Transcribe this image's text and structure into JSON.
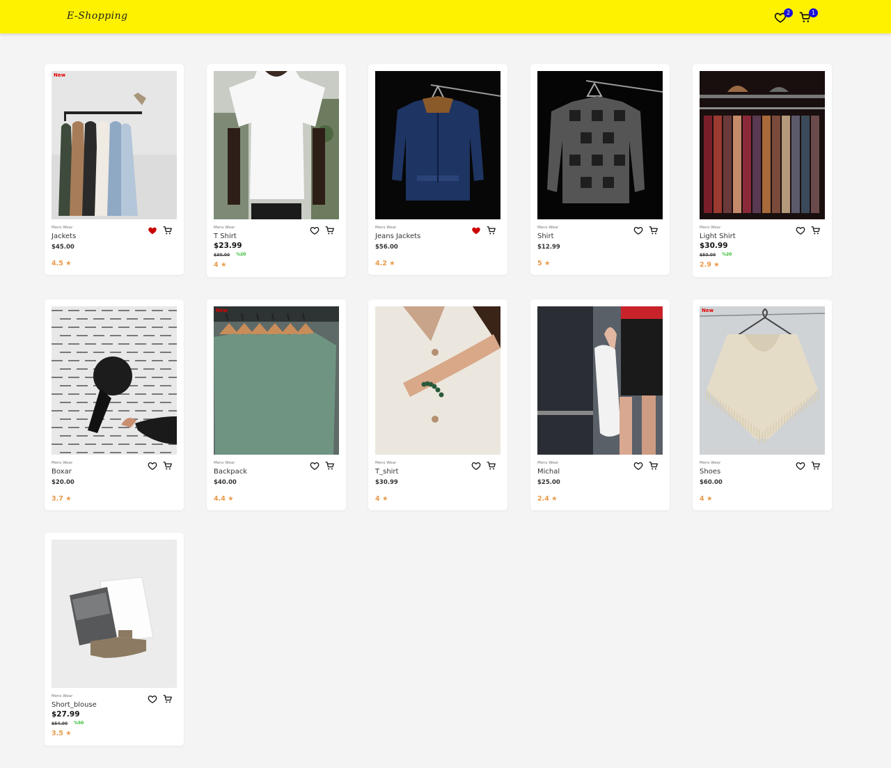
{
  "header": {
    "logo": "E-Shopping",
    "wishlist_count": "2",
    "cart_count": "1",
    "color": "#fff200"
  },
  "colors": {
    "badge": "#1a10d6",
    "rating": "#e99a4b",
    "new_tag": "#e00000",
    "discount": "#2cb82c",
    "favorite_active": "#cc0000"
  },
  "products": [
    {
      "name": "Jackets",
      "category": "Mens Wear",
      "price": "$45.00",
      "rating": "4.5",
      "tag": "New",
      "favorite": true,
      "image": "clothes-rack-jackets"
    },
    {
      "name": "T Shirt",
      "category": "Mens Wear",
      "price": "$23.99",
      "old_price": "$30.00",
      "discount": "%20",
      "rating": "4",
      "favorite": false,
      "image": "white-tshirt"
    },
    {
      "name": "Jeans Jackets",
      "category": "Mens Wear",
      "price": "$56.00",
      "rating": "4.2",
      "favorite": true,
      "image": "denim-jacket"
    },
    {
      "name": "Shirt",
      "category": "Mens Wear",
      "price": "$12.99",
      "rating": "5",
      "favorite": false,
      "image": "plaid-shirt"
    },
    {
      "name": "Light Shirt",
      "category": "Mens Wear",
      "price": "$30.99",
      "old_price": "$50.00",
      "discount": "%20",
      "rating": "2.9",
      "favorite": false,
      "image": "shirt-rack"
    },
    {
      "name": "Boxar",
      "category": "Mens Wear",
      "price": "$20.00",
      "rating": "3.7",
      "favorite": false,
      "image": "black-bag"
    },
    {
      "name": "Backpack",
      "category": "Mens Wear",
      "price": "$40.00",
      "rating": "4.4",
      "tag": "New",
      "favorite": false,
      "image": "green-tees"
    },
    {
      "name": "T_shirt",
      "category": "Mens Wear",
      "price": "$30.99",
      "rating": "4",
      "favorite": false,
      "image": "white-blouse"
    },
    {
      "name": "Michal",
      "category": "Mens Wear",
      "price": "$25.00",
      "rating": "2.4",
      "favorite": false,
      "image": "white-sneakers"
    },
    {
      "name": "Shoes",
      "category": "Mens Wear",
      "price": "$60.00",
      "rating": "4",
      "tag": "New",
      "favorite": false,
      "image": "knit-poncho"
    },
    {
      "name": "Short_blouse",
      "category": "Mens Wear",
      "price": "$27.99",
      "old_price": "$54.00",
      "discount": "%50",
      "rating": "3.5",
      "favorite": false,
      "image": "folded-outfit"
    }
  ]
}
